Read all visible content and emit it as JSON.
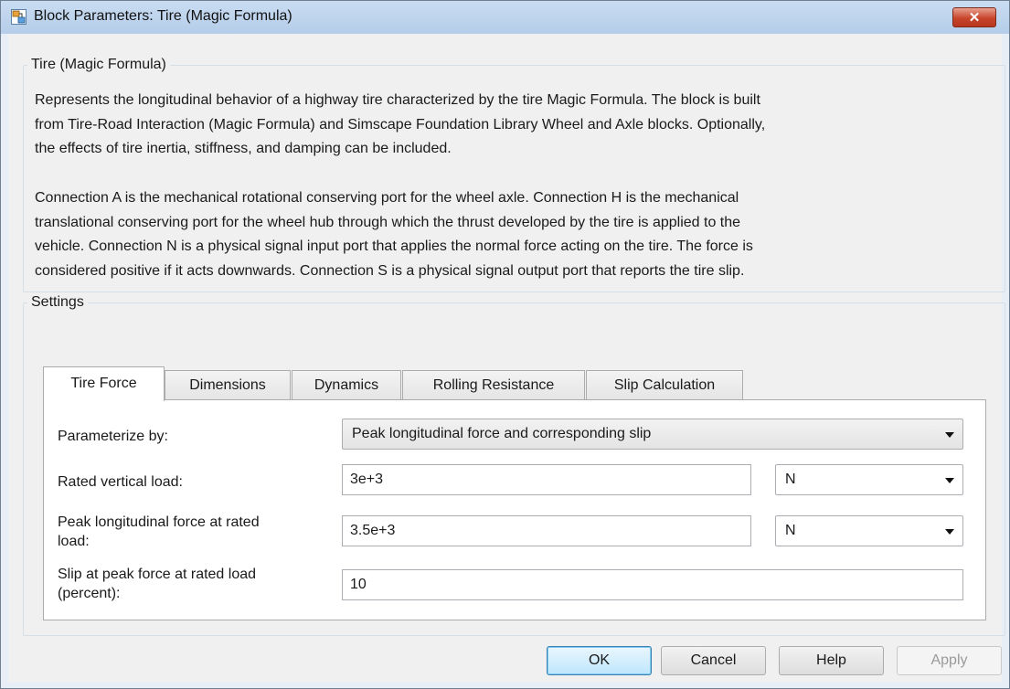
{
  "window": {
    "title": "Block Parameters: Tire (Magic Formula)",
    "close_label": "✕"
  },
  "description": {
    "group_title": "Tire (Magic Formula)",
    "para1": [
      "Represents the longitudinal behavior of a highway tire characterized by the tire Magic Formula. The block is built",
      "from Tire-Road Interaction (Magic Formula) and Simscape Foundation Library Wheel and Axle blocks. Optionally,",
      "the effects of tire inertia, stiffness, and damping can be included."
    ],
    "para2": [
      "Connection A is the mechanical rotational conserving port for the wheel axle. Connection H is the mechanical",
      "translational conserving port for the wheel hub through which the thrust developed by the tire is applied to the",
      "vehicle. Connection N is a physical signal input port that applies the normal force acting on the tire. The force is",
      "considered positive if it acts downwards. Connection S is a physical signal output port that reports the tire slip."
    ]
  },
  "settings": {
    "group_title": "Settings",
    "tabs": [
      {
        "label": "Tire Force",
        "active": true
      },
      {
        "label": "Dimensions",
        "active": false
      },
      {
        "label": "Dynamics",
        "active": false
      },
      {
        "label": "Rolling Resistance",
        "active": false
      },
      {
        "label": "Slip Calculation",
        "active": false
      }
    ],
    "parameterize": {
      "label": "Parameterize by:",
      "value": "Peak longitudinal force and corresponding slip"
    },
    "rated_load": {
      "label": "Rated vertical load:",
      "value": "3e+3",
      "unit": "N"
    },
    "peak_force": {
      "label_line1": "Peak longitudinal force at rated",
      "label_line2": "load:",
      "value": "3.5e+3",
      "unit": "N"
    },
    "slip_peak": {
      "label_line1": "Slip at peak force at rated load",
      "label_line2": "(percent):",
      "value": "10"
    }
  },
  "buttons": {
    "ok": "OK",
    "cancel": "Cancel",
    "help": "Help",
    "apply": "Apply"
  },
  "colors": {
    "titlebar": "#c9dcf1",
    "close_button": "#c7452b",
    "default_button_border": "#3c7fb1"
  }
}
